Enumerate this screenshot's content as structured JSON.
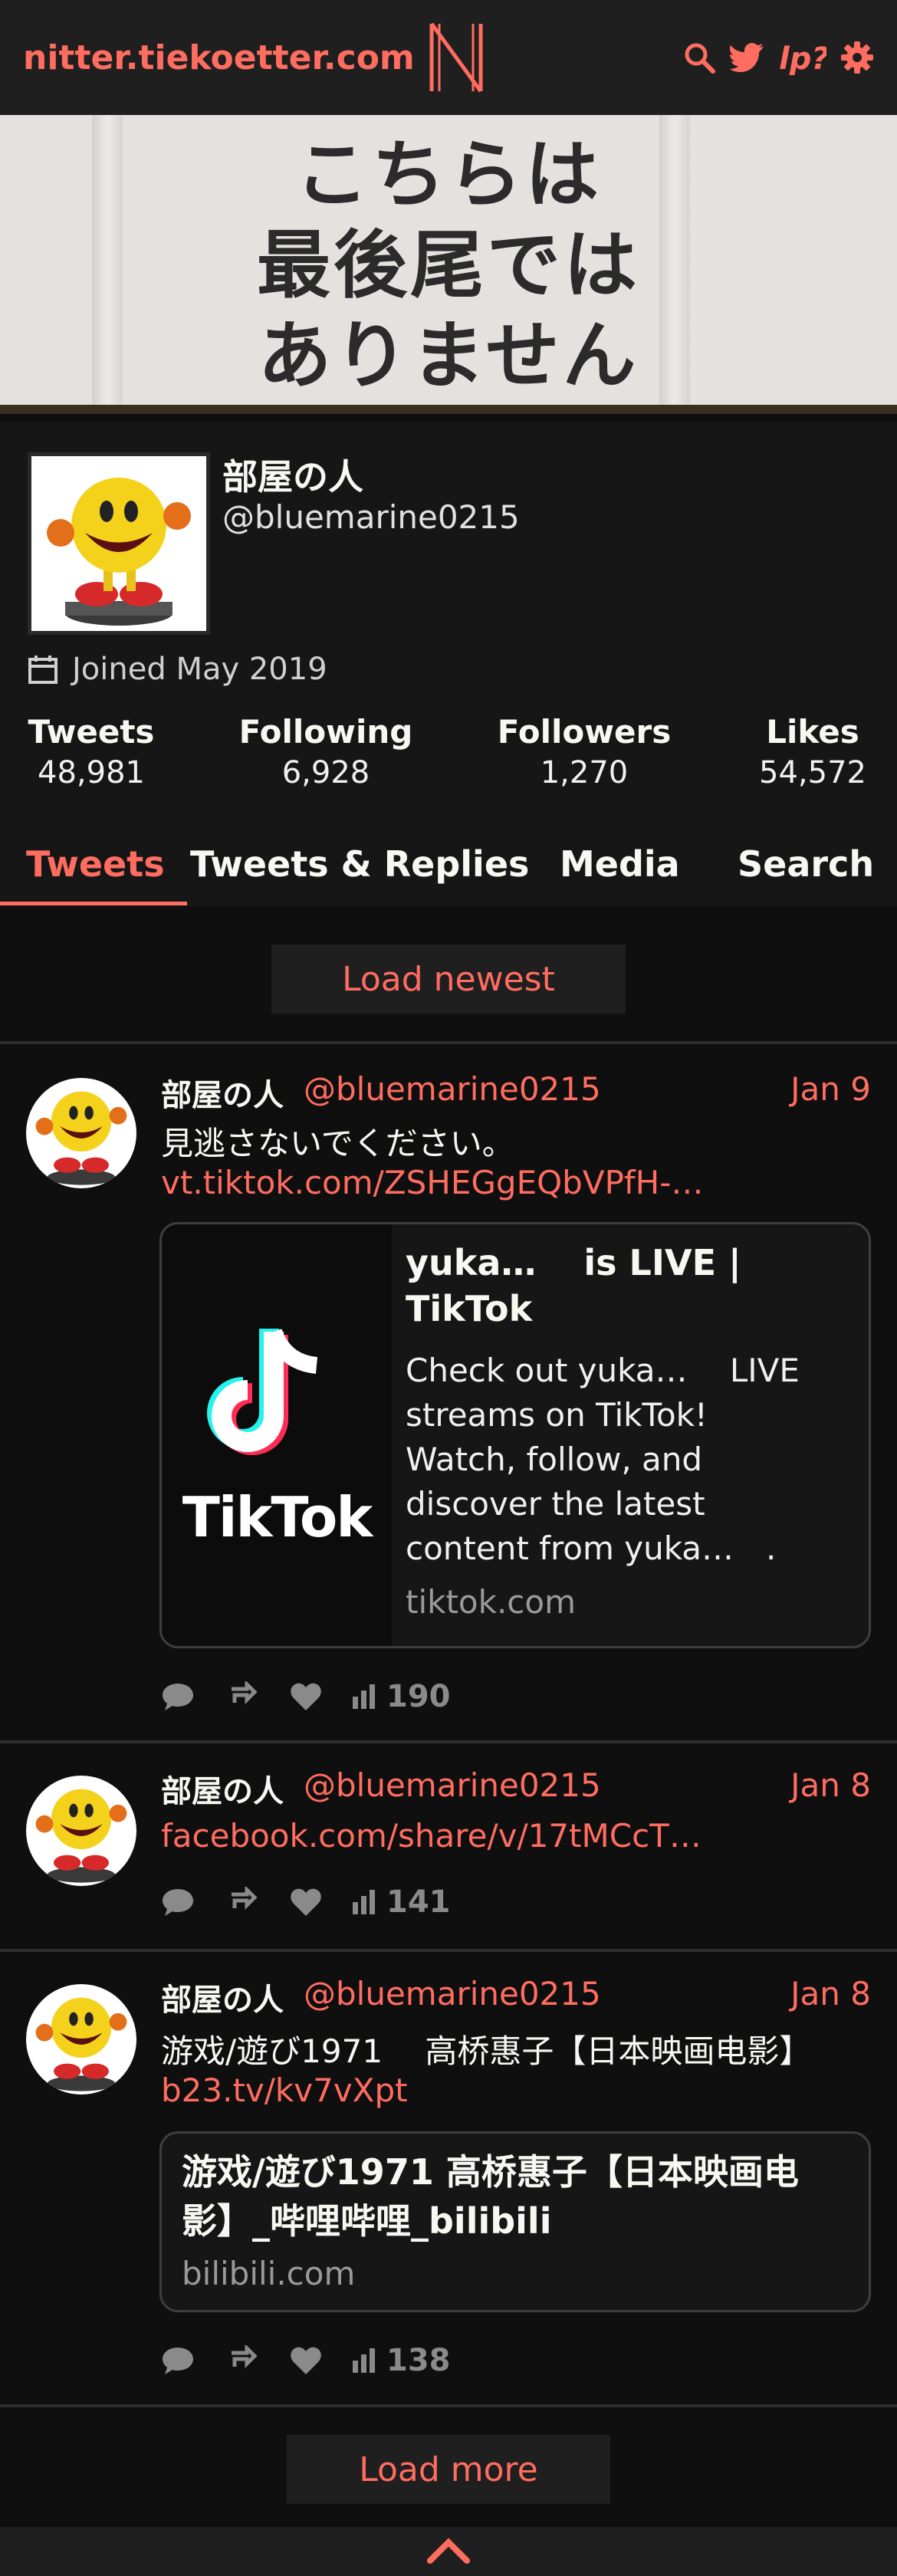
{
  "nav": {
    "site_name": "nitter.tiekoetter.com",
    "icons": [
      "search-icon",
      "twitter-icon",
      "rss-icon",
      "settings-icon"
    ]
  },
  "banner": {
    "lines": [
      "こちらは",
      "最後尾では",
      "ありません"
    ]
  },
  "profile": {
    "name": "部屋の人",
    "handle": "@bluemarine0215",
    "joined": "Joined May 2019",
    "stats": {
      "tweets_label": "Tweets",
      "tweets": "48,981",
      "following_label": "Following",
      "following": "6,928",
      "followers_label": "Followers",
      "followers": "1,270",
      "likes_label": "Likes",
      "likes": "54,572"
    }
  },
  "tabs": [
    "Tweets",
    "Tweets & Replies",
    "Media",
    "Search"
  ],
  "load_newest": "Load newest",
  "tweets": [
    {
      "name": "部屋の人",
      "handle": "@bluemarine0215",
      "date": "Jan 9",
      "text": "見逃さないでください。",
      "link": "vt.tiktok.com/ZSHEGgEQbVPfH-…",
      "card": {
        "image_label": "TikTok",
        "title_line1": "yuka…　 is LIVE |",
        "title_line2": "TikTok",
        "desc_lines": [
          "Check out yuka…　 LIVE",
          "streams on TikTok!",
          "Watch, follow, and",
          "discover the latest",
          "content from yuka…　."
        ],
        "domain": "tiktok.com"
      },
      "views": "190"
    },
    {
      "name": "部屋の人",
      "handle": "@bluemarine0215",
      "date": "Jan 8",
      "link": "facebook.com/share/v/17tMCcT…",
      "views": "141"
    },
    {
      "name": "部屋の人",
      "handle": "@bluemarine0215",
      "date": "Jan 8",
      "text": "游戏/遊び1971　 高桥惠子【日本映画电影】",
      "link": "b23.tv/kv7vXpt",
      "card": {
        "title_line1": "游戏/遊び1971 高桥惠子【日本映画电",
        "title_line2": "影】_哔哩哔哩_bilibili",
        "domain": "bilibili.com"
      },
      "views": "138"
    }
  ],
  "load_more": "Load more",
  "colors": {
    "accent": "#ff6c60",
    "background": "#0f0f0f",
    "panel": "#161616",
    "nav": "#1f1f1f"
  }
}
